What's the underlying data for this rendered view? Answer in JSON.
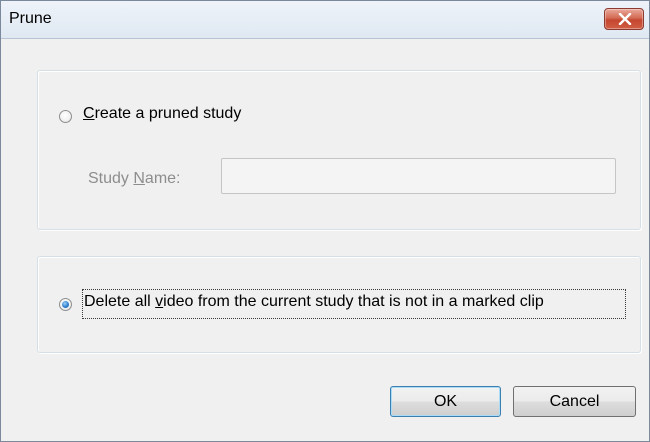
{
  "window": {
    "title": "Prune"
  },
  "options": {
    "create_pruned": {
      "accesskey_char": "C",
      "label_rest": "reate a pruned study",
      "checked": false
    },
    "study_name": {
      "label_before": "Study ",
      "accesskey_char": "N",
      "label_after": "ame:",
      "value": "",
      "enabled": false
    },
    "delete_video": {
      "label_before": "Delete all ",
      "accesskey_char": "v",
      "label_after": "ideo from the current study that is not in a marked clip",
      "checked": true
    }
  },
  "buttons": {
    "ok_label": "OK",
    "cancel_label": "Cancel"
  },
  "icons": {
    "close": "close-icon"
  },
  "colors": {
    "close_button": "#d15e43",
    "radio_selected": "#2f7fcf",
    "disabled_text": "#8d8d8d"
  }
}
